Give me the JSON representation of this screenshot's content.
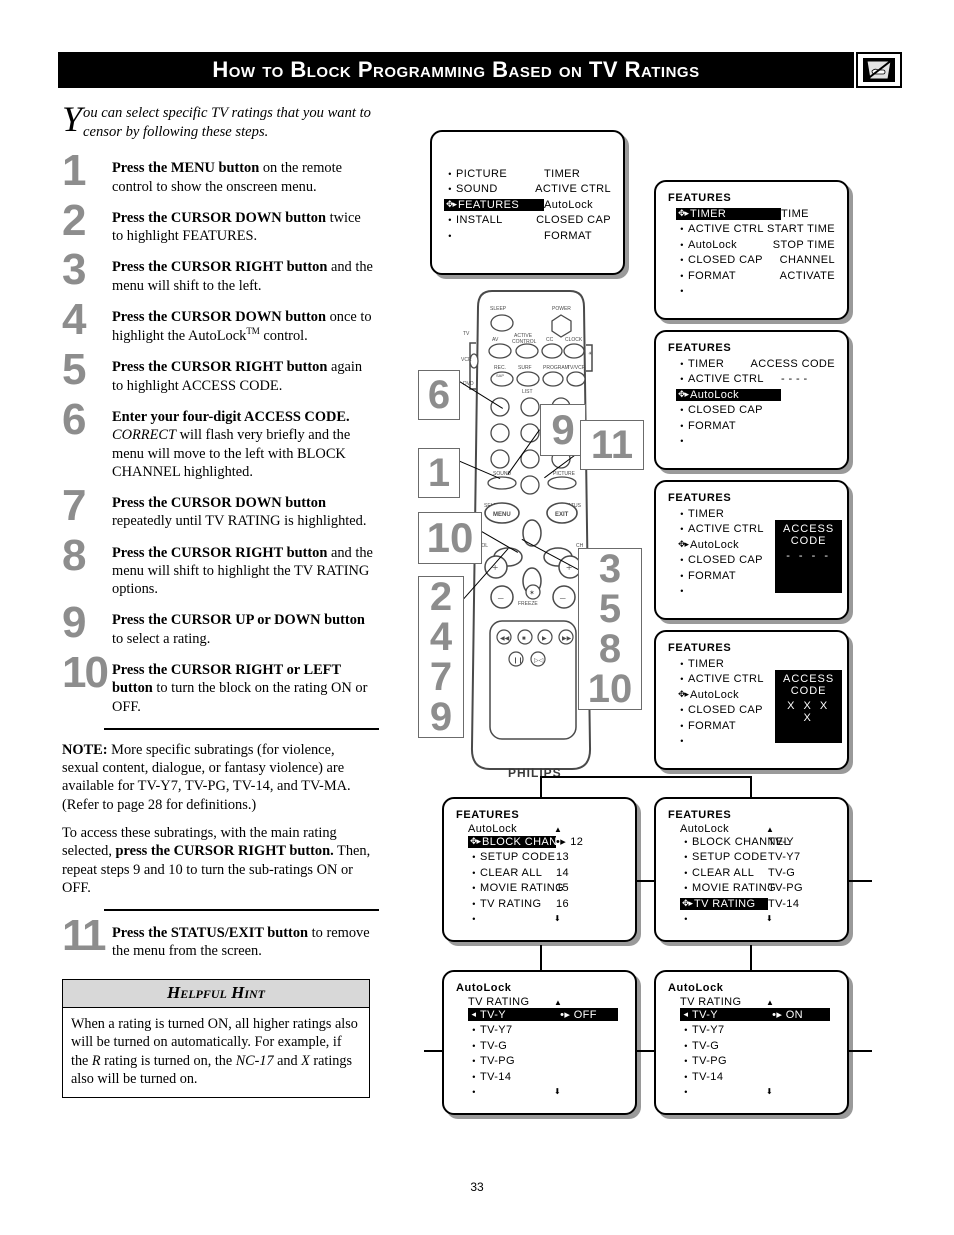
{
  "header": {
    "title": "How to Block Programming Based on TV Ratings",
    "icon": "blocked-tv-icon"
  },
  "page_number": "33",
  "intro": {
    "dropcap": "Y",
    "text": "ou can select specific TV ratings that you want to censor by following these steps."
  },
  "steps": [
    {
      "num": "1",
      "html": "<b>Press the MENU button</b> on the remote control to show the onscreen menu."
    },
    {
      "num": "2",
      "html": "<b>Press the CURSOR DOWN button</b> twice to highlight FEATURES."
    },
    {
      "num": "3",
      "html": "<b>Press the CURSOR RIGHT button</b> and the menu will shift to the left."
    },
    {
      "num": "4",
      "html": "<b>Press the CURSOR DOWN button</b> once to highlight the AutoLock<span class=\"sup\">TM</span> control."
    },
    {
      "num": "5",
      "html": "<b>Press the CURSOR RIGHT button</b> again to highlight ACCESS CODE."
    },
    {
      "num": "6",
      "html": "<b>Enter your four-digit ACCESS CODE.</b> <i>CORRECT</i> will flash very briefly and the menu will move to the left with BLOCK CHANNEL highlighted."
    },
    {
      "num": "7",
      "html": "<b>Press the CURSOR DOWN button</b> repeatedly until TV RATING is highlighted."
    },
    {
      "num": "8",
      "html": "<b>Press the CURSOR RIGHT button</b> and the menu will shift to highlight the TV RATING options."
    },
    {
      "num": "9",
      "html": "<b>Press the CURSOR UP or DOWN button</b> to select a rating."
    },
    {
      "num": "10",
      "html": "<b>Press the CURSOR RIGHT or LEFT button</b> to turn the block on the rating ON or OFF."
    }
  ],
  "note": {
    "p1": "<b>NOTE:</b> More specific subratings (for violence, sexual content, dialogue, or fantasy violence) are available for TV-Y7, TV-PG, TV-14, and TV-MA. (Refer to page 28 for definitions.)",
    "p2": "To access these subratings, with the main rating selected, <b>press the CURSOR RIGHT button.</b> Then, repeat steps 9 and 10 to turn the sub-ratings ON or OFF."
  },
  "step11": {
    "num": "11",
    "html": "<b>Press the STATUS/EXIT button</b> to remove the menu from the screen."
  },
  "hint": {
    "heading": "Helpful Hint",
    "body": "When a rating is turned ON, all higher ratings also will be turned on automatically.  For example, if the <i>R</i> rating is turned on, the <i>NC-17</i> and <i>X</i> ratings also will be turned on."
  },
  "remote": {
    "brand": "PHILIPS",
    "buttons": [
      "SLEEP",
      "POWER",
      "TV",
      "VCR",
      "DVD",
      "AV",
      "ACTIVE CONTROL",
      "CC",
      "CLOCK",
      "REC.",
      "SURF",
      "PROGRAM",
      "TV/VCR",
      "LIST",
      "SOUND",
      "PICTURE",
      "SELECT",
      "MENU",
      "STATUS",
      "EXIT",
      "VOL",
      "CH",
      "FREEZE"
    ],
    "callouts": [
      {
        "id": "callout-6",
        "lines": [
          "6"
        ]
      },
      {
        "id": "callout-9",
        "lines": [
          "9"
        ]
      },
      {
        "id": "callout-11",
        "lines": [
          "11"
        ]
      },
      {
        "id": "callout-1",
        "lines": [
          "1"
        ]
      },
      {
        "id": "callout-10",
        "lines": [
          "10"
        ]
      },
      {
        "id": "callout-left-stack",
        "lines": [
          "2",
          "4",
          "7",
          "9"
        ]
      },
      {
        "id": "callout-right-stack",
        "lines": [
          "3",
          "5",
          "8",
          "10"
        ]
      }
    ]
  },
  "osd": {
    "main_menu": {
      "left_items": [
        {
          "label": "PICTURE",
          "highlighted": false
        },
        {
          "label": "SOUND",
          "highlighted": false
        },
        {
          "label": "FEATURES",
          "highlighted": true
        },
        {
          "label": "INSTALL",
          "highlighted": false
        }
      ],
      "right_items": [
        "TIMER",
        "ACTIVE CTRL",
        "AutoLock",
        "CLOSED CAP",
        "FORMAT"
      ]
    },
    "features_timer": {
      "title": "FEATURES",
      "left_items": [
        {
          "label": "TIMER",
          "highlighted": true
        },
        {
          "label": "ACTIVE CTRL",
          "highlighted": false
        },
        {
          "label": "AutoLock",
          "highlighted": false
        },
        {
          "label": "CLOSED CAP",
          "highlighted": false
        },
        {
          "label": "FORMAT",
          "highlighted": false
        }
      ],
      "right_items": [
        "TIME",
        "START TIME",
        "STOP TIME",
        "CHANNEL",
        "ACTIVATE"
      ]
    },
    "features_autolock": {
      "title": "FEATURES",
      "left_items": [
        {
          "label": "TIMER",
          "highlighted": false
        },
        {
          "label": "ACTIVE CTRL",
          "highlighted": false
        },
        {
          "label": "AutoLock",
          "highlighted": true
        },
        {
          "label": "CLOSED CAP",
          "highlighted": false
        },
        {
          "label": "FORMAT",
          "highlighted": false
        }
      ],
      "right_items": [
        "ACCESS CODE",
        "- - - -"
      ]
    },
    "features_access_empty": {
      "title": "FEATURES",
      "left_items": [
        {
          "label": "TIMER",
          "highlighted": false
        },
        {
          "label": "ACTIVE CTRL",
          "highlighted": false
        },
        {
          "label": "AutoLock",
          "highlighted": false
        },
        {
          "label": "CLOSED CAP",
          "highlighted": false
        },
        {
          "label": "FORMAT",
          "highlighted": false
        }
      ],
      "access_box": {
        "line1": "ACCESS CODE",
        "line2": "- - - -"
      }
    },
    "features_access_filled": {
      "title": "FEATURES",
      "left_items": [
        {
          "label": "TIMER",
          "highlighted": false
        },
        {
          "label": "ACTIVE CTRL",
          "highlighted": false
        },
        {
          "label": "AutoLock",
          "highlighted": false
        },
        {
          "label": "CLOSED CAP",
          "highlighted": false
        },
        {
          "label": "FORMAT",
          "highlighted": false
        }
      ],
      "access_box": {
        "line1": "ACCESS CODE",
        "line2": "X X X X"
      }
    },
    "block_channel": {
      "title": "FEATURES",
      "subtitle": "AutoLock",
      "left_items": [
        {
          "label": "BLOCK CHANNEL",
          "highlighted": true
        },
        {
          "label": "SETUP CODE",
          "highlighted": false
        },
        {
          "label": "CLEAR ALL",
          "highlighted": false
        },
        {
          "label": "MOVIE RATING",
          "highlighted": false
        },
        {
          "label": "TV RATING",
          "highlighted": false
        }
      ],
      "right_items": [
        "12",
        "13",
        "14",
        "15",
        "16"
      ]
    },
    "tv_rating_menu": {
      "title": "FEATURES",
      "subtitle": "AutoLock",
      "left_items": [
        {
          "label": "BLOCK CHANNEL",
          "highlighted": false
        },
        {
          "label": "SETUP CODE",
          "highlighted": false
        },
        {
          "label": "CLEAR ALL",
          "highlighted": false
        },
        {
          "label": "MOVIE RATING",
          "highlighted": false
        },
        {
          "label": "TV RATING",
          "highlighted": true
        }
      ],
      "right_items": [
        "TV-Y",
        "TV-Y7",
        "TV-G",
        "TV-PG",
        "TV-14"
      ]
    },
    "rating_off": {
      "title": "AutoLock",
      "subtitle": "TV RATING",
      "left_items": [
        {
          "label": "TV-Y",
          "highlighted": true
        },
        {
          "label": "TV-Y7",
          "highlighted": false
        },
        {
          "label": "TV-G",
          "highlighted": false
        },
        {
          "label": "TV-PG",
          "highlighted": false
        },
        {
          "label": "TV-14",
          "highlighted": false
        }
      ],
      "value": "OFF"
    },
    "rating_on": {
      "title": "AutoLock",
      "subtitle": "TV RATING",
      "left_items": [
        {
          "label": "TV-Y",
          "highlighted": true
        },
        {
          "label": "TV-Y7",
          "highlighted": false
        },
        {
          "label": "TV-G",
          "highlighted": false
        },
        {
          "label": "TV-PG",
          "highlighted": false
        },
        {
          "label": "TV-14",
          "highlighted": false
        }
      ],
      "value": "ON"
    }
  }
}
